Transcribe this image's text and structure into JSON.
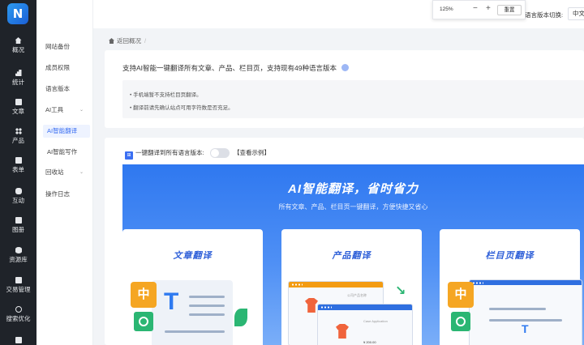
{
  "rail": {
    "items": [
      {
        "label": "概况",
        "icon": "home-icon"
      },
      {
        "label": "统计",
        "icon": "chart-icon"
      },
      {
        "label": "文章",
        "icon": "article-icon"
      },
      {
        "label": "产品",
        "icon": "grid-icon"
      },
      {
        "label": "表单",
        "icon": "form-icon"
      },
      {
        "label": "互动",
        "icon": "chat-icon"
      },
      {
        "label": "图册",
        "icon": "gallery-icon"
      },
      {
        "label": "资源库",
        "icon": "database-icon"
      },
      {
        "label": "交易管理",
        "icon": "bag-icon"
      },
      {
        "label": "搜索优化",
        "icon": "target-icon"
      }
    ]
  },
  "sidebar": {
    "items": [
      {
        "label": "网站备份"
      },
      {
        "label": "成员权限"
      },
      {
        "label": "语言版本"
      },
      {
        "label": "AI工具",
        "expand": "⌄"
      },
      {
        "label": "AI智能翻译"
      },
      {
        "label": "AI智能写作"
      },
      {
        "label": "回收站",
        "expand": "⌄"
      },
      {
        "label": "操作日志"
      }
    ]
  },
  "zoom": {
    "value": "125%",
    "minus": "−",
    "plus": "+",
    "reset": "重置"
  },
  "header": {
    "lang_label": "语言版本切换:",
    "lang_value": "中文"
  },
  "breadcrumb": {
    "back": "返回概况",
    "sep": "/"
  },
  "info": {
    "title": "支持AI智能一键翻译所有文章、产品、栏目页，支持现有49种语言版本",
    "notes": [
      "• 手机端暂不支持栏目页翻译。",
      "• 翻译前请先确认站点可用字符数是否充足。"
    ]
  },
  "options": {
    "checkbox_glyph": "⊞",
    "translate_all": "一键翻译到所有语言版本:",
    "example_link": "【查看示例】"
  },
  "banner": {
    "title": "AI智能翻译，省时省力",
    "subtitle": "所有文章、产品、栏目页一键翻译，方便快捷又省心",
    "features": [
      {
        "title": "文章翻译"
      },
      {
        "title": "产品翻译"
      },
      {
        "title": "栏目页翻译"
      }
    ],
    "badge_char": "中",
    "doc_letter": "T",
    "arrow_glyph": "↘",
    "tiny_texts": [
      "公司产品名称",
      "Case Application",
      "¥ 200.00"
    ]
  },
  "colors": {
    "accent": "#3b6ff2",
    "banner": "#2f78f0",
    "rail": "#1f2329"
  }
}
